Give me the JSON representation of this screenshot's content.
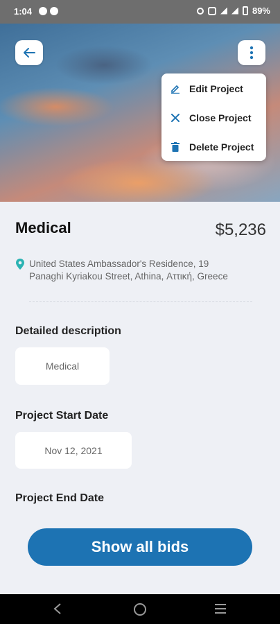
{
  "status_bar": {
    "time": "1:04",
    "battery": "89%"
  },
  "header": {
    "back_icon": "arrow-left-icon",
    "more_icon": "more-vertical-icon"
  },
  "menu": {
    "items": [
      {
        "label": "Edit Project",
        "icon": "pencil-icon"
      },
      {
        "label": "Close Project",
        "icon": "close-icon"
      },
      {
        "label": "Delete Project",
        "icon": "trash-icon"
      }
    ]
  },
  "project": {
    "title": "Medical",
    "price": "$5,236",
    "address_line1": "United States Ambassador's Residence, 19",
    "address_line2": "Panaghi Kyriakou Street, Athina, Αττική, Greece"
  },
  "sections": {
    "description_label": "Detailed description",
    "description_value": "Medical",
    "start_label": "Project Start Date",
    "start_value": "Nov 12, 2021",
    "end_label": "Project End Date"
  },
  "actions": {
    "show_bids": "Show all bids"
  },
  "colors": {
    "accent": "#1d73b3",
    "pin": "#2bb3b3"
  }
}
